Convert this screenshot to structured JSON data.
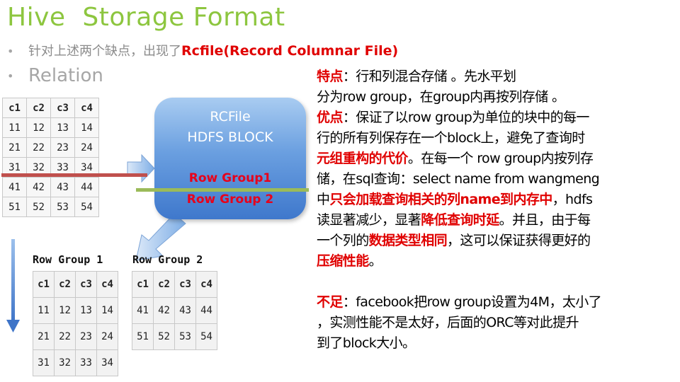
{
  "title": "Hive  Storage Format",
  "bullets": {
    "b1_prefix": "针对上述两个缺点，出现了",
    "b1_highlight": "Rcfile(Record   Columnar File)",
    "b2": "Relation"
  },
  "relation_table": {
    "headers": [
      "c1",
      "c2",
      "c3",
      "c4"
    ],
    "rows": [
      [
        "11",
        "12",
        "13",
        "14"
      ],
      [
        "21",
        "22",
        "23",
        "24"
      ],
      [
        "31",
        "32",
        "33",
        "34"
      ],
      [
        "41",
        "42",
        "43",
        "44"
      ],
      [
        "51",
        "52",
        "53",
        "54"
      ]
    ]
  },
  "rcfile_box": {
    "line1": "RCFile",
    "line2": "HDFS BLOCK",
    "group1": "Row Group1",
    "group2": "Row Group 2"
  },
  "row_group_1": {
    "title": "Row Group 1",
    "headers": [
      "c1",
      "c2",
      "c3",
      "c4"
    ],
    "rows": [
      [
        "11",
        "12",
        "13",
        "14"
      ],
      [
        "21",
        "22",
        "23",
        "24"
      ],
      [
        "31",
        "32",
        "33",
        "34"
      ]
    ]
  },
  "row_group_2": {
    "title": "Row Group 2",
    "headers": [
      "c1",
      "c2",
      "c3",
      "c4"
    ],
    "rows": [
      [
        "41",
        "42",
        "43",
        "44"
      ],
      [
        "51",
        "52",
        "53",
        "54"
      ]
    ]
  },
  "description": {
    "l1a": "特点",
    "l1b": "：行和列混合存储 。先水平划",
    "l2": "分为row group，在group内再按列存储  。",
    "l3a": "优点",
    "l3b": "：保证了以row group为单位的块中的每一",
    "l4": "行的所有列保存在一个block上，避免了查询时",
    "l5a": "元组重构的代价",
    "l5b": "。在每一个 row group内按列存",
    "l6": "储，在sql查询：select name from  wangmeng",
    "l7a": "中",
    "l7b": "只会加载查询相关的列name到内存中",
    "l7c": "，hdfs",
    "l8a": "读显著减少，显著",
    "l8b": "降低查询时延",
    "l8c": "。并且，由于每",
    "l9a": "一个列的",
    "l9b": "数据类型相同",
    "l9c": "，这可以保证获得更好的",
    "l10": "压缩性能",
    "l10b": "。",
    "l11a": "不足",
    "l11b": "：facebook把row group设置为4M，太小了",
    "l12": "，实测性能不是太好，后面的ORC等对此提升",
    "l13": "到了block大小。"
  },
  "colors": {
    "title": "#8dc63f",
    "highlight_red": "#e00000",
    "box_blue": "#4f86d4",
    "row_line_red": "#c0504d",
    "row_line_green": "#9bbb59"
  }
}
